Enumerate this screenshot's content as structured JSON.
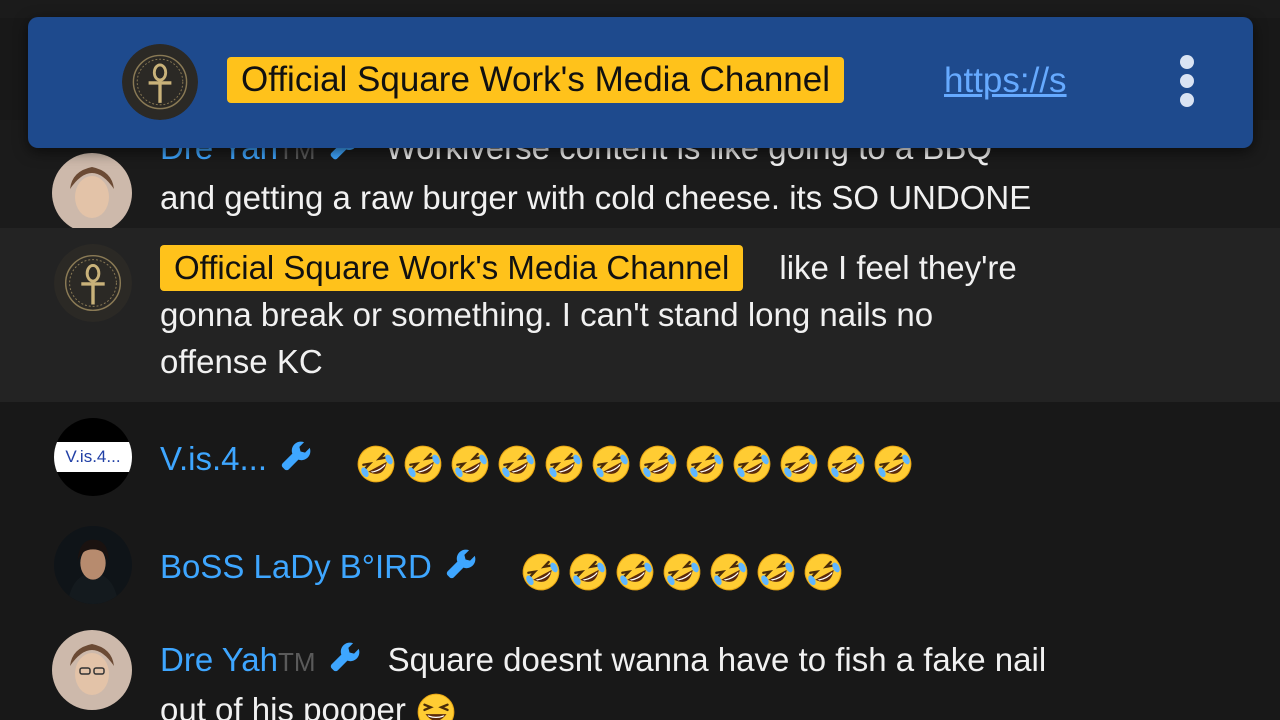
{
  "banner": {
    "channel_name": "Official Square Work's Media Channel",
    "link_text": "https://s",
    "avatar_icon": "ankh-logo-icon",
    "menu_icon": "more-vert-icon"
  },
  "messages": [
    {
      "author": "Dre Yah",
      "tm": "TM",
      "badge_icon": "wrench-icon",
      "text": "Workiverse content is like going to a BBQ and getting a raw burger with cold cheese. its SO UNDONE",
      "text_line1": "Workiverse content is like going to a BBQ",
      "text_line2": "and getting a raw burger with cold cheese. its SO UNDONE"
    },
    {
      "author": "Official Square Work's Media Channel",
      "is_owner": true,
      "text_line1": "like I feel they're",
      "text_line2": "gonna break or something. I can't stand long nails no",
      "text_line3": "offense KC"
    },
    {
      "author": "V.is.4...",
      "avatar_text": "V.is.4...",
      "badge_icon": "wrench-icon",
      "emoji": "rolling-on-floor-laughing",
      "emoji_count": 12
    },
    {
      "author": "BoSS LaDy B°IRD",
      "badge_icon": "wrench-icon",
      "emoji": "rolling-on-floor-laughing",
      "emoji_count": 7
    },
    {
      "author": "Dre Yah",
      "tm": "TM",
      "badge_icon": "wrench-icon",
      "text_line1": "Square doesnt wanna have to fish a fake nail",
      "text_line2": "out of his pooper",
      "trailing_emoji": "grinning-squinting-face"
    }
  ],
  "colors": {
    "banner_bg": "#1e4a8d",
    "owner_chip": "#ffc21b",
    "author_blue": "#3ea6ff",
    "background": "#181818",
    "highlight_row": "#232323"
  }
}
